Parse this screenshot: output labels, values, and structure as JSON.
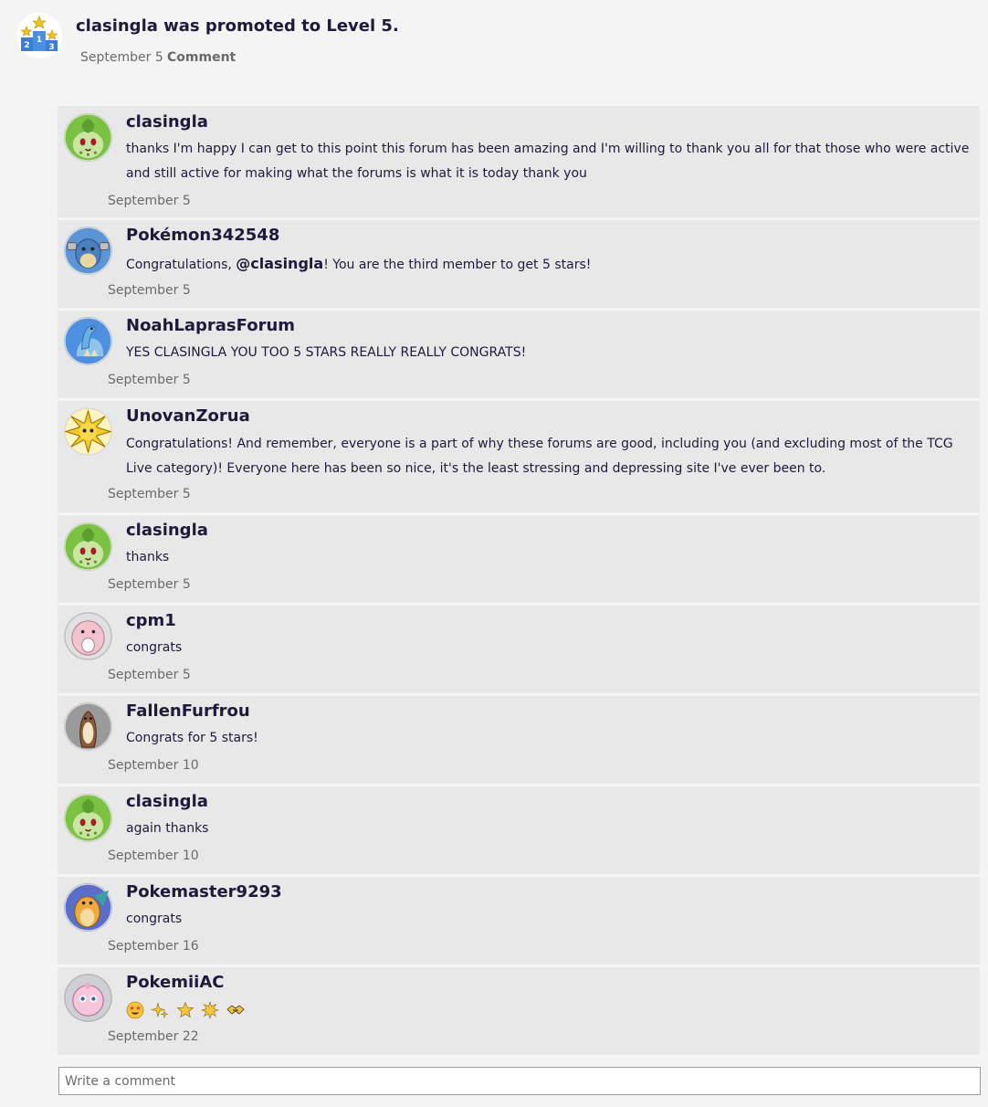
{
  "activity": {
    "title": "clasingla was promoted to Level 5.",
    "date": "September 5",
    "comment_label": "Comment",
    "icon": "podium-icon"
  },
  "comments": [
    {
      "author": "clasingla",
      "avatar": "chikorita-avatar",
      "text": "thanks I'm happy I can get to this point this forum has been amazing and I'm willing to thank you all for that those who were active and still active for making what the forums is what it is today thank you",
      "date": "September 5"
    },
    {
      "author": "Pokémon342548",
      "avatar": "blastoise-avatar",
      "text_before": "Congratulations, ",
      "mention": "@clasingla",
      "text_after": "! You are the third member to get 5 stars!",
      "date": "September 5"
    },
    {
      "author": "NoahLaprasForum",
      "avatar": "lapras-avatar",
      "text": "YES CLASINGLA YOU TOO 5 STARS REALLY REALLY CONGRATS!",
      "date": "September 5"
    },
    {
      "author": "UnovanZorua",
      "avatar": "jolteon-avatar",
      "text": "Congratulations! And remember, everyone is a part of why these forums are good, including you (and excluding most of the TCG Live category)! Everyone here has been so nice, it's the least stressing and depressing site I've ever been to.",
      "date": "September 5"
    },
    {
      "author": "clasingla",
      "avatar": "chikorita-avatar",
      "text": "thanks",
      "date": "September 5"
    },
    {
      "author": "cpm1",
      "avatar": "chansey-avatar",
      "text": "congrats",
      "date": "September 5"
    },
    {
      "author": "FallenFurfrou",
      "avatar": "furret-avatar",
      "text": "Congrats for 5 stars!",
      "date": "September 10"
    },
    {
      "author": "clasingla",
      "avatar": "chikorita-avatar",
      "text": "again thanks",
      "date": "September 10"
    },
    {
      "author": "Pokemaster9293",
      "avatar": "dragonite-avatar",
      "text": "congrats",
      "date": "September 16"
    },
    {
      "author": "PokemiiAC",
      "avatar": "jigglypuff-avatar",
      "emojis": [
        "star-struck-emoji",
        "sparkles-emoji",
        "star-emoji",
        "dizzy-emoji",
        "handshake-emoji"
      ],
      "date": "September 22"
    }
  ],
  "write_comment": {
    "placeholder": "Write a comment"
  }
}
